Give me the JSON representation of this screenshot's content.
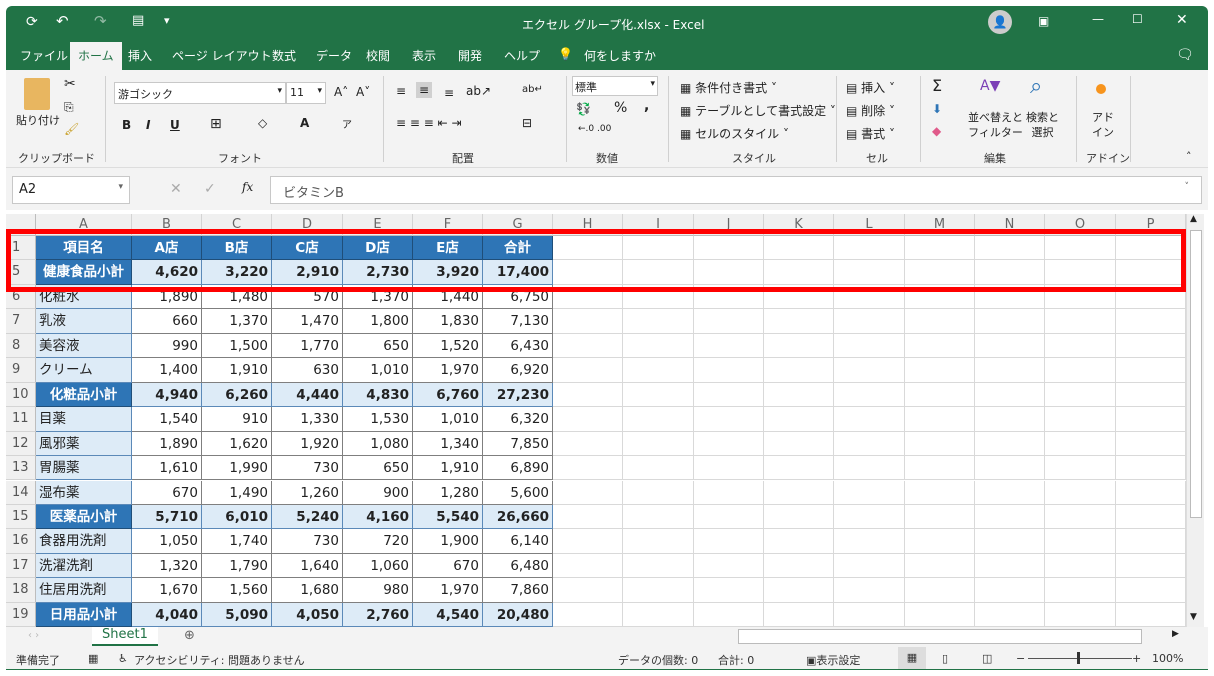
{
  "title": "エクセル グループ化.xlsx  -  Excel",
  "tabs": [
    "ファイル",
    "ホーム",
    "挿入",
    "ページ レイアウト",
    "数式",
    "データ",
    "校閲",
    "表示",
    "開発",
    "ヘルプ"
  ],
  "tell_me": "何をしますか",
  "ribbon": {
    "paste": "貼り付け",
    "clipboard": "クリップボード",
    "font_name": "游ゴシック",
    "font_size": "11",
    "font": "フォント",
    "bold": "B",
    "italic": "I",
    "underline": "U",
    "alignment": "配置",
    "number_format": "標準",
    "number": "数値",
    "cond_format": "条件付き書式",
    "table_format": "テーブルとして書式設定",
    "cell_style": "セルのスタイル",
    "styles": "スタイル",
    "insert": "挿入",
    "delete": "削除",
    "format": "書式",
    "cells": "セル",
    "sort_filter": "並べ替えと\nフィルター",
    "find_select": "検索と\n選択",
    "editing": "編集",
    "addin": "アド\nイン",
    "addins": "アドイン"
  },
  "formula_bar": {
    "name_box": "A2",
    "fx": "fx",
    "value": "ビタミンB"
  },
  "columns": [
    "A",
    "B",
    "C",
    "D",
    "E",
    "F",
    "G",
    "H",
    "I",
    "J",
    "K",
    "L",
    "M",
    "N",
    "O",
    "P"
  ],
  "rows": [
    {
      "num": "1",
      "type": "header",
      "cells": [
        "項目名",
        "A店",
        "B店",
        "C店",
        "D店",
        "E店",
        "合計"
      ]
    },
    {
      "num": "5",
      "type": "subtotal",
      "cells": [
        "健康食品小計",
        "4,620",
        "3,220",
        "2,910",
        "2,730",
        "3,920",
        "17,400"
      ]
    },
    {
      "num": "6",
      "type": "item",
      "cells": [
        "化粧水",
        "1,890",
        "1,480",
        "570",
        "1,370",
        "1,440",
        "6,750"
      ]
    },
    {
      "num": "7",
      "type": "item",
      "cells": [
        "乳液",
        "660",
        "1,370",
        "1,470",
        "1,800",
        "1,830",
        "7,130"
      ]
    },
    {
      "num": "8",
      "type": "item",
      "cells": [
        "美容液",
        "990",
        "1,500",
        "1,770",
        "650",
        "1,520",
        "6,430"
      ]
    },
    {
      "num": "9",
      "type": "item",
      "cells": [
        "クリーム",
        "1,400",
        "1,910",
        "630",
        "1,010",
        "1,970",
        "6,920"
      ]
    },
    {
      "num": "10",
      "type": "subtotal",
      "cells": [
        "化粧品小計",
        "4,940",
        "6,260",
        "4,440",
        "4,830",
        "6,760",
        "27,230"
      ]
    },
    {
      "num": "11",
      "type": "item",
      "cells": [
        "目薬",
        "1,540",
        "910",
        "1,330",
        "1,530",
        "1,010",
        "6,320"
      ]
    },
    {
      "num": "12",
      "type": "item",
      "cells": [
        "風邪薬",
        "1,890",
        "1,620",
        "1,920",
        "1,080",
        "1,340",
        "7,850"
      ]
    },
    {
      "num": "13",
      "type": "item",
      "cells": [
        "胃腸薬",
        "1,610",
        "1,990",
        "730",
        "650",
        "1,910",
        "6,890"
      ]
    },
    {
      "num": "14",
      "type": "item",
      "cells": [
        "湿布薬",
        "670",
        "1,490",
        "1,260",
        "900",
        "1,280",
        "5,600"
      ]
    },
    {
      "num": "15",
      "type": "subtotal",
      "cells": [
        "医薬品小計",
        "5,710",
        "6,010",
        "5,240",
        "4,160",
        "5,540",
        "26,660"
      ]
    },
    {
      "num": "16",
      "type": "item",
      "cells": [
        "食器用洗剤",
        "1,050",
        "1,740",
        "730",
        "720",
        "1,900",
        "6,140"
      ]
    },
    {
      "num": "17",
      "type": "item",
      "cells": [
        "洗濯洗剤",
        "1,320",
        "1,790",
        "1,640",
        "1,060",
        "670",
        "6,480"
      ]
    },
    {
      "num": "18",
      "type": "item",
      "cells": [
        "住居用洗剤",
        "1,670",
        "1,560",
        "1,680",
        "980",
        "1,970",
        "7,860"
      ]
    },
    {
      "num": "19",
      "type": "subtotal",
      "cells": [
        "日用品小計",
        "4,040",
        "5,090",
        "4,050",
        "2,760",
        "4,540",
        "20,480"
      ]
    }
  ],
  "sheet_tab": "Sheet1",
  "status": {
    "ready": "準備完了",
    "accessibility": "アクセシビリティ: 問題ありません",
    "count": "データの個数: 0",
    "sum": "合計: 0",
    "display_settings": "表示設定",
    "zoom": "100%"
  },
  "colors": {
    "excel_green": "#217346",
    "header_blue": "#2e75b6",
    "light_blue": "#ddebf7",
    "highlight": "#ff0000"
  }
}
